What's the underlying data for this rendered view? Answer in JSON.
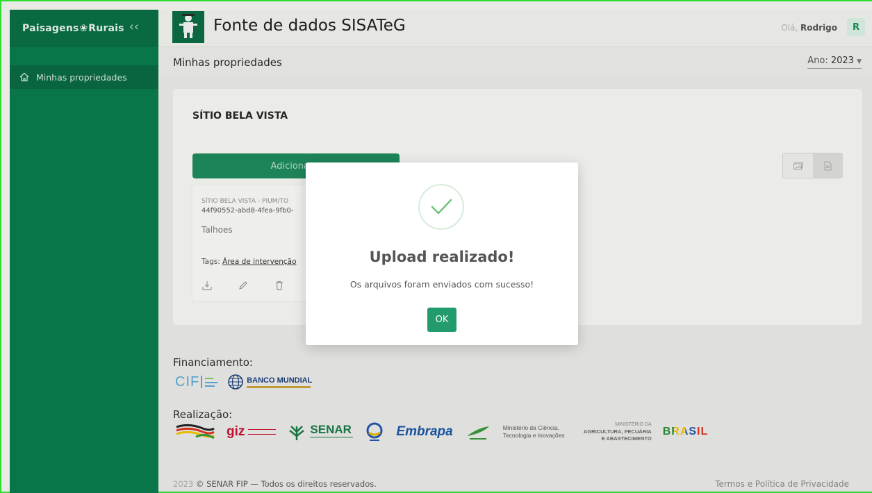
{
  "sidebar": {
    "brand_left": "Paisagens",
    "brand_right": "Rurais",
    "items": [
      {
        "label": "Minhas propriedades",
        "icon": "home-icon"
      }
    ]
  },
  "header": {
    "title": "Fonte de dados SISATeG",
    "greeting_prefix": "Olá,",
    "user_name": "Rodrigo",
    "avatar_initial": "R"
  },
  "subbar": {
    "title": "Minhas propriedades",
    "year_label": "Ano:",
    "year_value": "2023"
  },
  "property": {
    "name": "SÍTIO BELA VISTA",
    "add_button_label": "Adicionar a",
    "file_card": {
      "name": "SÍTIO BELA VISTA - PIUM/TO",
      "id": "44f90552-abd8-4fea-9fb0-",
      "type": "Talhoes",
      "tags_label": "Tags:",
      "tag": "Área de intervenção"
    }
  },
  "footer": {
    "financing_label": "Financiamento:",
    "realization_label": "Realização:",
    "copyright_year": "2023",
    "copyright_text": "© SENAR FIP — Todos os direitos reservados.",
    "terms_link": "Termos e Política de Privacidade",
    "logos": {
      "cif": "CIF",
      "banco_mundial": "BANCO MUNDIAL",
      "giz": "giz",
      "senar": "SENAR",
      "embrapa": "Embrapa",
      "mcti": "Ministério da Ciência, Tecnologia e Inovações",
      "mapa_top": "MINISTÉRIO DA",
      "mapa": "AGRICULTURA, PECUÁRIA E ABASTECIMENTO",
      "brasil": "BRASIL"
    }
  },
  "modal": {
    "title": "Upload realizado!",
    "message": "Os arquivos foram enviados com sucesso!",
    "ok_label": "OK"
  },
  "colors": {
    "sidebar_green": "#0a7b4c",
    "accent_green": "#229b6d",
    "check_green": "#6cc57a"
  }
}
